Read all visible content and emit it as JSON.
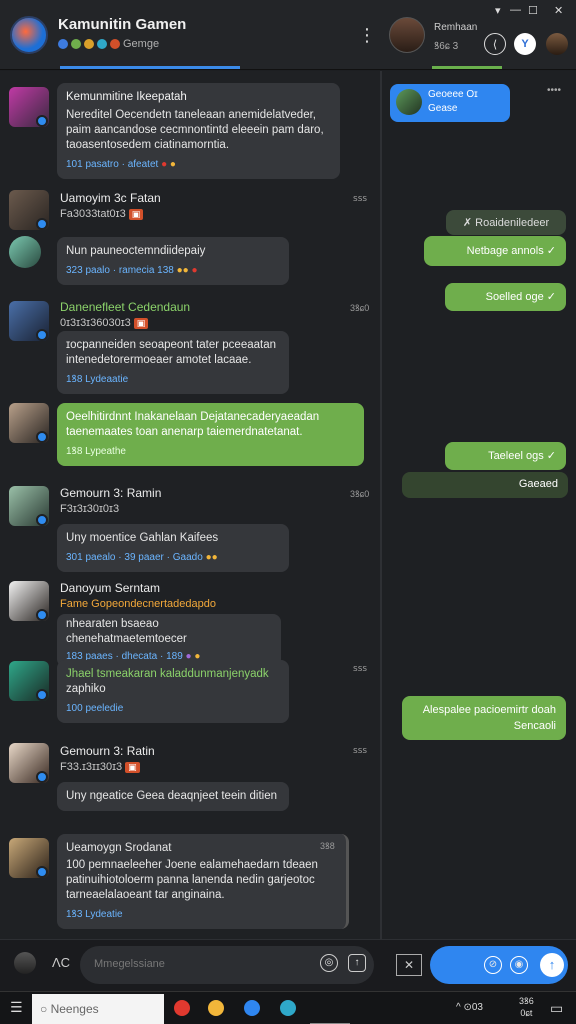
{
  "header": {
    "title": "Kamunitin Gamen",
    "subtitle": "Gemge",
    "kebab": "⋮",
    "right_name": "Remhaan",
    "right_sub": "ꝸ6ɕ 3",
    "win_min": "▾",
    "win_dash": "—",
    "win_max": "☐",
    "win_close": "✕"
  },
  "messages": [
    {
      "name": "Kemunmitine Ikeepatah",
      "body": [
        "Nereditel Oecendetn taneleaan anemidelatveder,",
        "paim aancandose cecmnontintd eleeein pam daro,",
        "taoasentosedem ciatinamorntia."
      ],
      "foot": "101 pasatro · afeatet",
      "time": ""
    },
    {
      "name": "Uamoyim 3c Fatan",
      "meta": "Fa3033tat0ɪ3",
      "body": [
        "Nun pauneoctemndiidepaiy"
      ],
      "foot": "323 paalo · ramecia 138",
      "time": "ꜱꜱꜱ"
    },
    {
      "name": "Danenefleet Cedendaun",
      "meta": "0ɪ3ɪ3ɪ36030ɪ3",
      "body": [
        "ɪocpanneiden seoapeont tater pceeaatan",
        "intenedetorermoeaer amotet lacaae."
      ],
      "foot": "1ꝸ8 Lydeaatie",
      "time": "3ꝸɕ0"
    },
    {
      "name": "",
      "body": [
        "Oeelhitirdnnt Inakanelaan Dejatanecaderyaeadan",
        "taenemaates toan anenarp taiemerdnatetanat."
      ],
      "foot": "1ꝸ8 Lypeathe",
      "green": true,
      "time": ""
    },
    {
      "name": "Gemourn 3: Ramin",
      "meta": "F3ɪ3ɪ30ɪ0ɪ3",
      "body": [
        "Uny moentice Gahlan Kaifees"
      ],
      "foot": "301 paealo · 39 paaer · Gaado",
      "time": "3ꝸɕ0"
    },
    {
      "name": "Danoyum Serntam",
      "meta": "Fame Gopeondecnertadedapdo",
      "body": [
        "nhearaten bsaeao chenehatmaetemtoecer"
      ],
      "foot": "183 paaes · dhecata · 189",
      "time": ""
    },
    {
      "name": "",
      "body": [
        "Jhael tsmeakaran kaladdunmanjenyadk",
        "zaphiko"
      ],
      "foot": "100 peeledie",
      "time": "ꜱꜱꜱ",
      "greenName": true
    },
    {
      "name": "Gemourn 3: Ratin",
      "meta": "F33.ɪ3ɪɪ30ɪ3",
      "body": [
        "Uny ngeatice Geea deaqnjeet teein ditien"
      ],
      "foot": "",
      "time": "ꜱꜱꜱ"
    },
    {
      "name": "Ueamoygn Srodanat",
      "body": [
        "100 pemnaeleeher Joene ealamehaedarn tdeaen",
        "patinuihiotoloerm panna lanenda nedin garjeotoc",
        "tarneaelalaoeant tar anginaina."
      ],
      "foot": "1ꝸ3 Lydeatie",
      "time": "3ꝸ8"
    }
  ],
  "right_messages": [
    {
      "text": "Geoeee Oɪ\nGease",
      "style": "blue"
    },
    {
      "text": "✗ Roaideniledeer",
      "style": "dark"
    },
    {
      "text": "Netbage annols ✓",
      "style": "green"
    },
    {
      "text": "Soelled oge ✓",
      "style": "green"
    },
    {
      "text": "Taeleel ogs ✓",
      "style": "green"
    },
    {
      "text": "Gaeaed",
      "style": "darkgreen"
    },
    {
      "text": "Alespalee pacioemirtr doah\nSencaoli",
      "style": "green"
    }
  ],
  "input": {
    "placeholder": "Mmegelssiane",
    "prefix": "ɅC"
  },
  "taskbar": {
    "search": "Neenges",
    "clock1": "3ꝸ6",
    "clock2": "0ɕt",
    "tray": "⊙03"
  },
  "colors": {
    "accent": "#3b8be9",
    "green": "#6fae4c"
  }
}
